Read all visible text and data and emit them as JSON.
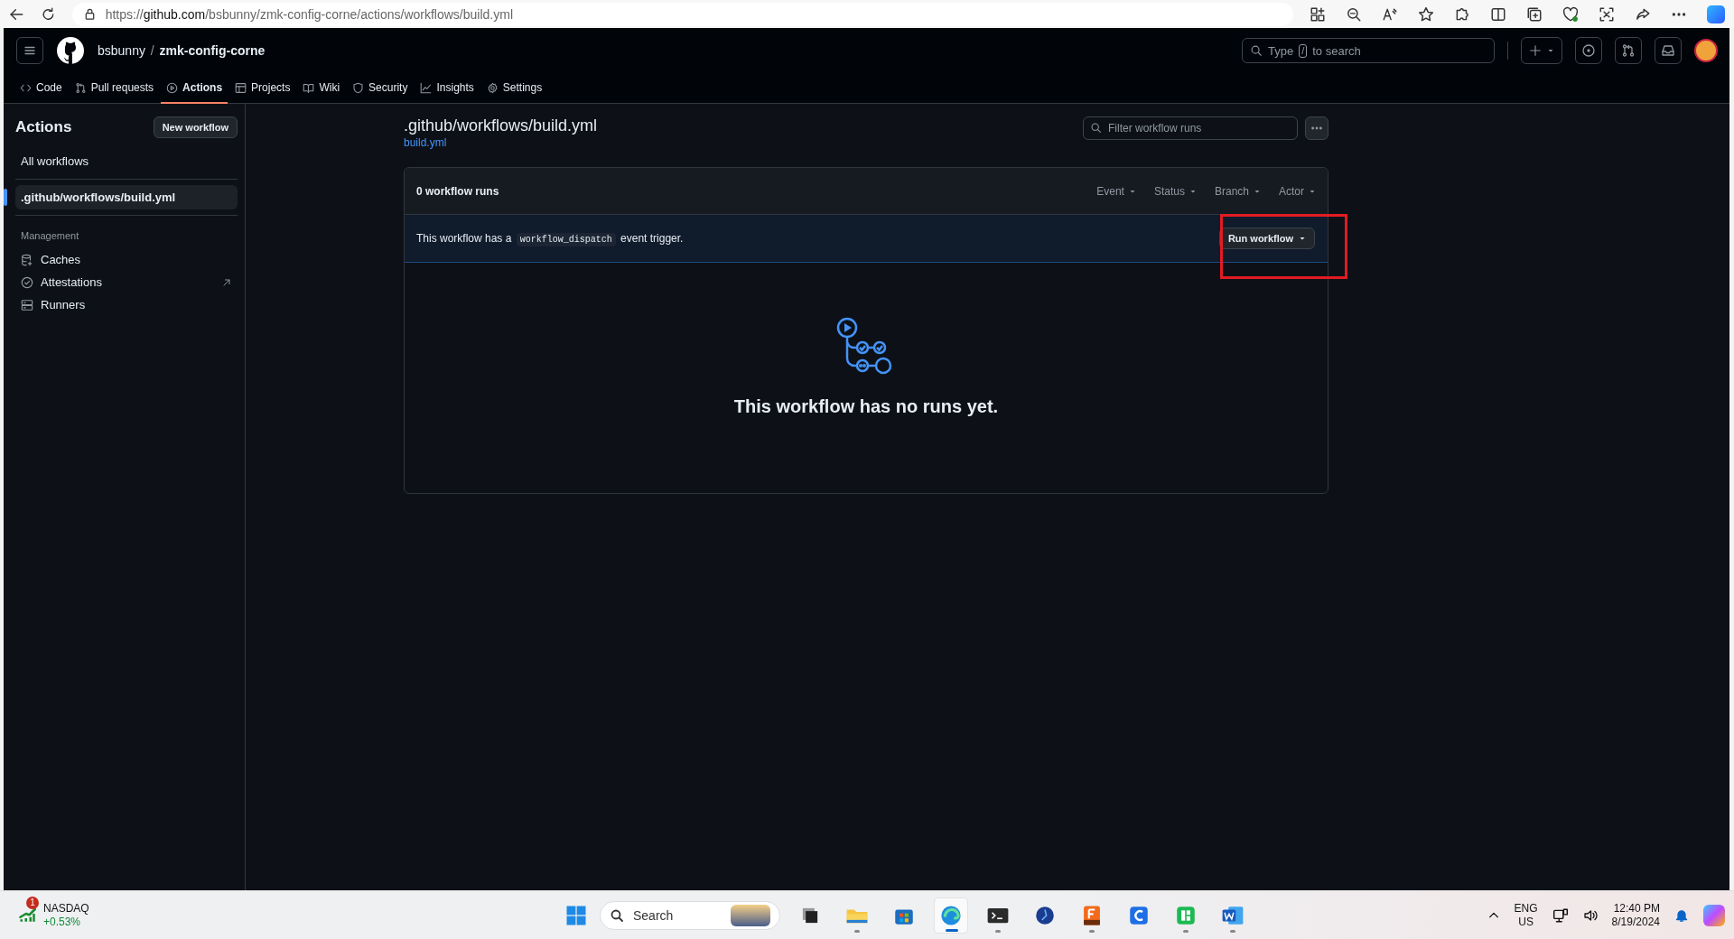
{
  "browser": {
    "url": {
      "scheme": "https://",
      "host": "github.com",
      "path": "/bsbunny/zmk-config-corne/actions/workflows/build.yml"
    }
  },
  "repo": {
    "owner": "bsbunny",
    "separator": "/",
    "name": "zmk-config-corne"
  },
  "search": {
    "hint_start": "Type",
    "key": "/",
    "hint_end": "to search"
  },
  "nav_tabs": [
    {
      "label": "Code",
      "selected": false
    },
    {
      "label": "Pull requests",
      "selected": false
    },
    {
      "label": "Actions",
      "selected": true
    },
    {
      "label": "Projects",
      "selected": false
    },
    {
      "label": "Wiki",
      "selected": false
    },
    {
      "label": "Security",
      "selected": false
    },
    {
      "label": "Insights",
      "selected": false
    },
    {
      "label": "Settings",
      "selected": false
    }
  ],
  "sidebar": {
    "title": "Actions",
    "new_button": "New workflow",
    "items": [
      {
        "label": "All workflows",
        "selected": false
      },
      {
        "label": ".github/workflows/build.yml",
        "selected": true
      }
    ],
    "section": "Management",
    "management": [
      {
        "label": "Caches",
        "external": false
      },
      {
        "label": "Attestations",
        "external": true
      },
      {
        "label": "Runners",
        "external": false
      }
    ]
  },
  "workflow": {
    "title": ".github/workflows/build.yml",
    "file_link": "build.yml",
    "filter_placeholder": "Filter workflow runs",
    "run_count": "0 workflow runs",
    "filters": [
      "Event",
      "Status",
      "Branch",
      "Actor"
    ],
    "trigger_before": "This workflow has a",
    "trigger_code": "workflow_dispatch",
    "trigger_after": "event trigger.",
    "run_button": "Run workflow",
    "empty_message": "This workflow has no runs yet."
  },
  "taskbar": {
    "ticker": {
      "badge": "1",
      "name": "NASDAQ",
      "change": "+0.53%"
    },
    "search": "Search",
    "apps": [
      {
        "kind": "taskview",
        "running": false,
        "active": false
      },
      {
        "kind": "files",
        "running": true,
        "active": false
      },
      {
        "kind": "store",
        "running": false,
        "active": false
      },
      {
        "kind": "browser",
        "running": true,
        "active": true
      },
      {
        "kind": "terminal",
        "running": true,
        "active": false
      },
      {
        "kind": "disc",
        "running": false,
        "active": false
      },
      {
        "kind": "fusion",
        "running": true,
        "active": false
      },
      {
        "kind": "letter",
        "running": false,
        "active": false
      },
      {
        "kind": "sheet",
        "running": true,
        "active": false
      },
      {
        "kind": "word",
        "running": true,
        "active": false
      }
    ],
    "language": {
      "top": "ENG",
      "bottom": "US"
    },
    "clock": {
      "time": "12:40 PM",
      "date": "8/19/2024"
    }
  }
}
